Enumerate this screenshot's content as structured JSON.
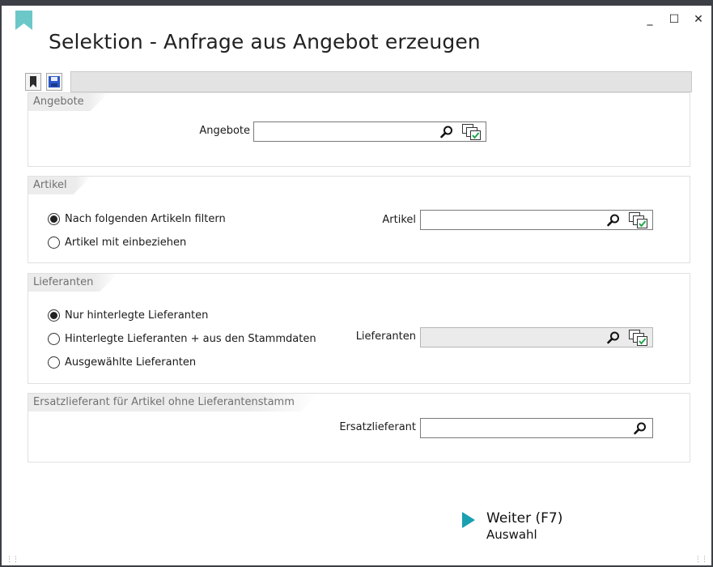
{
  "window": {
    "title": "Selektion - Anfrage aus Angebot erzeugen",
    "controls": {
      "minimize": "_",
      "maximize": "☐",
      "close": "✕"
    }
  },
  "toolbar": {
    "icons": [
      "bookmark-icon",
      "save-icon"
    ]
  },
  "groups": {
    "angebote": {
      "header": "Angebote",
      "field_label": "Angebote",
      "field_value": ""
    },
    "artikel": {
      "header": "Artikel",
      "options": [
        "Nach folgenden Artikeln filtern",
        "Artikel mit einbeziehen"
      ],
      "selected_index": 0,
      "field_label": "Artikel",
      "field_value": ""
    },
    "lieferanten": {
      "header": "Lieferanten",
      "options": [
        "Nur hinterlegte Lieferanten",
        "Hinterlegte Lieferanten + aus den Stammdaten",
        "Ausgewählte Lieferanten"
      ],
      "selected_index": 0,
      "field_label": "Lieferanten",
      "field_value": ""
    },
    "ersatz": {
      "header": "Ersatzlieferant für Artikel ohne Lieferantenstamm",
      "field_label": "Ersatzlieferant",
      "field_value": ""
    }
  },
  "next_action": {
    "label": "Weiter (F7)",
    "sublabel": "Auswahl"
  },
  "colors": {
    "accent": "#1aa0b0",
    "frame": "#3c3f45"
  }
}
